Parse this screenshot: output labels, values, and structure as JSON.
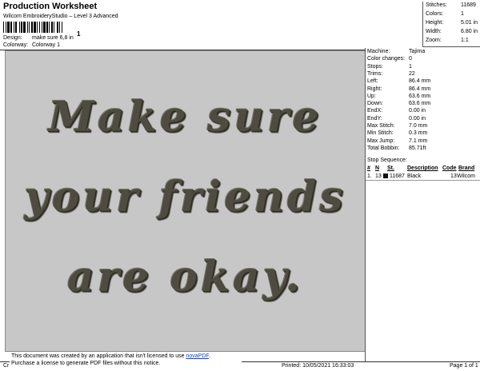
{
  "header": {
    "title": "Production Worksheet",
    "subtitle": "Wilcom EmbroideryStudio – Level 3 Advanced",
    "barcode_digit": "1",
    "design_label": "Design:",
    "design_value": "make sure 6,8 in",
    "colorway_label": "Colorway:",
    "colorway_value": "Colorway 1"
  },
  "stats": [
    {
      "label": "Stitches:",
      "value": "11689"
    },
    {
      "label": "Colors:",
      "value": "1"
    },
    {
      "label": "Height:",
      "value": "5.01 in"
    },
    {
      "label": "Width:",
      "value": "6.80 in"
    },
    {
      "label": "Zoom:",
      "value": "1:1"
    }
  ],
  "design_preview": {
    "lines": [
      "Make sure",
      "your friends",
      "are okay."
    ],
    "thread_color": "#4e4c40",
    "background_color": "#c7c7c7"
  },
  "machine_info": [
    {
      "label": "Machine:",
      "value": "Tajima"
    },
    {
      "label": "Color changes:",
      "value": "0"
    },
    {
      "label": "Stops:",
      "value": "1"
    },
    {
      "label": "Trims:",
      "value": "22"
    },
    {
      "label": "Left:",
      "value": "86.4 mm"
    },
    {
      "label": "Right:",
      "value": "86.4 mm"
    },
    {
      "label": "Up:",
      "value": "63.6 mm"
    },
    {
      "label": "Down:",
      "value": "63.6 mm"
    },
    {
      "label": "EndX:",
      "value": "0.00 in"
    },
    {
      "label": "EndY:",
      "value": "0.00 in"
    },
    {
      "label": "Max Stitch:",
      "value": "7.0 mm"
    },
    {
      "label": "Min Stitch:",
      "value": "0.3 mm"
    },
    {
      "label": "Max Jump:",
      "value": "7.1 mm"
    },
    {
      "label": "Total Bobbin:",
      "value": "85.71ft"
    }
  ],
  "stop_sequence": {
    "title": "Stop Sequence:",
    "columns": [
      "#",
      "N",
      "St.",
      "Description",
      "Code",
      "Brand"
    ],
    "rows": [
      {
        "num": "1.",
        "n": "13",
        "stitches": "11687",
        "description": "Black",
        "code": "13",
        "brand": "Wilcom",
        "color": "#111111"
      }
    ]
  },
  "footer": {
    "left": "Cr",
    "printed": "Printed: 10/05/2021 16:33:03",
    "page": "Page 1 of 1"
  },
  "notice": {
    "line1_prefix": "This document was created by an application that isn't licensed to use ",
    "link_text": "novaPDF",
    "line1_suffix": ".",
    "line2": "Purchase a license to generate PDF files without this notice."
  }
}
